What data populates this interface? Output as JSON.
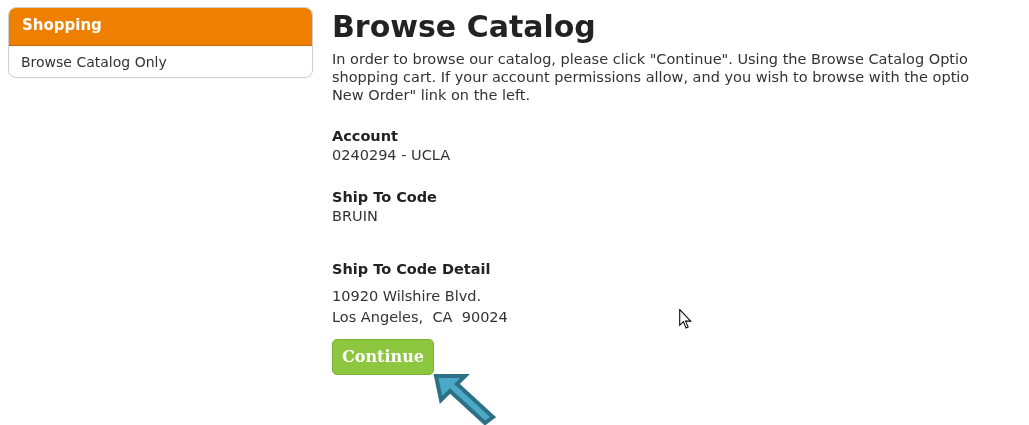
{
  "sidebar": {
    "title": "Shopping",
    "items": [
      {
        "label": "Browse Catalog Only"
      }
    ]
  },
  "main": {
    "title": "Browse Catalog",
    "intro_lines": [
      "In order to browse our catalog, please click \"Continue\". Using the Browse Catalog Optio",
      "shopping cart. If your account permissions allow, and you wish to browse with the optio",
      "New Order\" link on the left."
    ],
    "fields": [
      {
        "label": "Account",
        "lines": [
          "0240294 - UCLA"
        ]
      },
      {
        "label": "Ship To Code",
        "lines": [
          "BRUIN"
        ]
      },
      {
        "label": "Ship To Code Detail",
        "lines": [
          "10920 Wilshire Blvd.",
          "Los Angeles,  CA  90024"
        ]
      }
    ],
    "button": "Continue"
  }
}
